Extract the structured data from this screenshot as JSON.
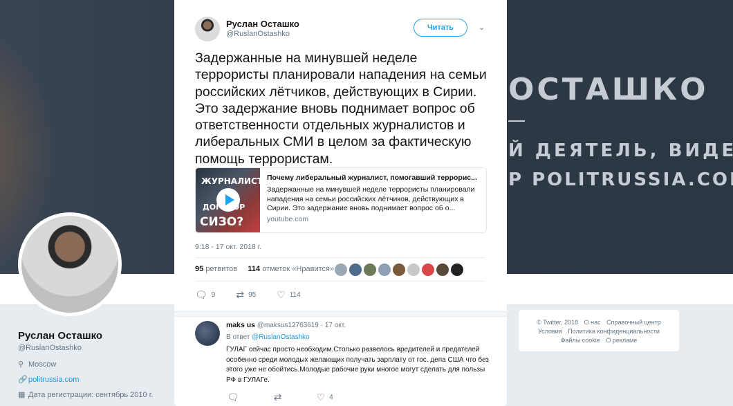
{
  "banner": {
    "line1": "ОСТАШКО",
    "line2": "Й ДЕЯТЕЛЬ, ВИДЕО",
    "line3": "Р POLITRUSSIA.COM"
  },
  "profile": {
    "name": "Руслан Осташко",
    "handle": "@RuslanOstashko",
    "location": "Moscow",
    "website": "politrussia.com",
    "joined": "Дата регистрации: сентябрь 2010 г."
  },
  "footer": {
    "links": [
      "© Twitter, 2018",
      "О нас",
      "Справочный центр",
      "Условия",
      "Политика конфиденциальности",
      "Файлы cookie",
      "О рекламе"
    ]
  },
  "tweet": {
    "author_name": "Руслан Осташко",
    "author_handle": "@RuslanOstashko",
    "follow_label": "Читать",
    "text": "Задержанные на минувшей неделе террористы планировали нападения на семьи российских лётчиков, действующих в Сирии. Это задержание вновь поднимает вопрос об ответственности отдельных журналистов и либеральных СМИ в целом за фактическую помощь террористам.",
    "card": {
      "thumb_text_1": "ЖУРНАЛИСТ",
      "thumb_text_2": "ДОГОВОР",
      "thumb_text_3": "СИЗО?",
      "title": "Почему либеральный журналист, помогавший террорис...",
      "description": "Задержанные на минувшей неделе террористы планировали нападения на семьи российских лётчиков, действующих в Сирии. Это задержание вновь поднимает вопрос об о...",
      "url": "youtube.com"
    },
    "time": "9:18 - 17 окт. 2018 г.",
    "retweets_count": "95",
    "retweets_label": "ретвитов",
    "likes_count": "114",
    "likes_label": "отметок «Нравится»",
    "reply_count": "9",
    "retweet_count": "95",
    "like_count": "114"
  },
  "reply": {
    "name": "maks us",
    "handle": "@maksus12763619",
    "date": "· 17 окт.",
    "in_reply_prefix": "В ответ",
    "in_reply_handle": "@RuslanOstashko",
    "text": "ГУЛАГ сейчас просто необходим.Столько развелось вредителей и предателей особенно среди молодых желающих получать зарплату от гос. депа США что без этого уже не обойтись.Молодые рабочие руки многое могут сделать для пользы РФ в ГУЛАГе.",
    "reply_count": "",
    "retweet_count": "",
    "like_count": "4"
  },
  "colors": {
    "accent": "#1da1f2",
    "link": "#1b95e0",
    "muted": "#657786",
    "liker_colors": [
      "#9aa7b4",
      "#4d6b8a",
      "#6c7a5a",
      "#8fa0b5",
      "#7a5a3a",
      "#c9c9c9",
      "#d94848",
      "#5a4a3a",
      "#222222"
    ]
  }
}
